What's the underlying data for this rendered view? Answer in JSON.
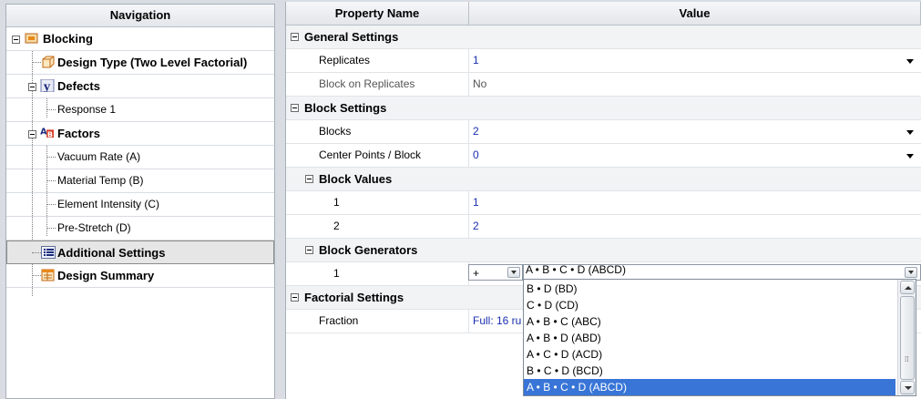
{
  "navigation": {
    "header": "Navigation",
    "items": [
      {
        "label": "Blocking"
      },
      {
        "label": "Design Type (Two Level Factorial)"
      },
      {
        "label": "Defects"
      },
      {
        "label": "Response 1"
      },
      {
        "label": "Factors"
      },
      {
        "label": "Vacuum Rate (A)"
      },
      {
        "label": "Material Temp (B)"
      },
      {
        "label": "Element Intensity (C)"
      },
      {
        "label": "Pre-Stretch (D)"
      },
      {
        "label": "Additional Settings"
      },
      {
        "label": "Design Summary"
      }
    ],
    "selected": "Additional Settings"
  },
  "grid": {
    "headers": {
      "name": "Property Name",
      "value": "Value"
    },
    "general": {
      "title": "General Settings",
      "replicates": {
        "name": "Replicates",
        "value": "1"
      },
      "block_on_replicates": {
        "name": "Block on Replicates",
        "value": "No"
      }
    },
    "block": {
      "title": "Block Settings",
      "blocks": {
        "name": "Blocks",
        "value": "2"
      },
      "center_points": {
        "name": "Center Points / Block",
        "value": "0"
      },
      "block_values": {
        "title": "Block Values",
        "rows": [
          {
            "name": "1",
            "value": "1"
          },
          {
            "name": "2",
            "value": "2"
          }
        ]
      },
      "block_generators": {
        "title": "Block Generators",
        "row_name": "1",
        "sign": "+",
        "generator": "A • B • C • D (ABCD)"
      }
    },
    "factorial": {
      "title": "Factorial Settings",
      "fraction": {
        "name": "Fraction",
        "value": "Full: 16 ru"
      }
    }
  },
  "generator_dropdown": {
    "options": [
      "B • D (BD)",
      "C • D (CD)",
      "A • B • C (ABC)",
      "A • B • D (ABD)",
      "A • C • D (ACD)",
      "B • C • D (BCD)",
      "A • B • C • D (ABCD)"
    ],
    "selected": "A • B • C • D (ABCD)"
  }
}
